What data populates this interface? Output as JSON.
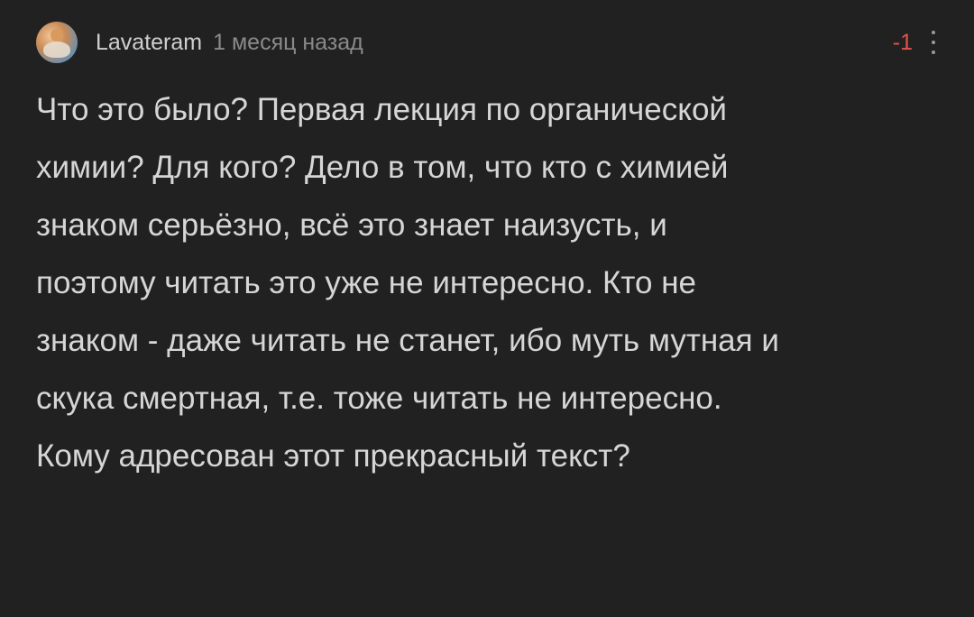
{
  "comment": {
    "author": "Lavateram",
    "time": "1 месяц назад",
    "rating": "-1",
    "lines": [
      "Что это было? Первая лекция по органической",
      "химии? Для кого? Дело в том, что кто с химией",
      "знаком серьёзно, всё это знает наизусть, и",
      "поэтому читать это уже не интересно. Кто не",
      "знаком - даже читать не станет, ибо муть мутная и",
      "скука смертная, т.е. тоже читать не интересно.",
      "Кому адресован этот прекрасный текст?"
    ]
  },
  "icons": {
    "avatar": "user-avatar-icon",
    "more": "more-vertical-icon"
  },
  "colors": {
    "background": "#212121",
    "text": "#d6d6d6",
    "muted": "#8a8a8a",
    "rating_negative": "#e0554a"
  }
}
